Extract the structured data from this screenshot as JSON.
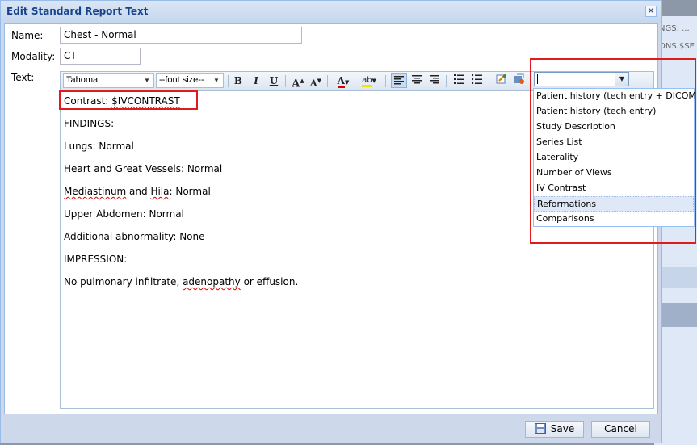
{
  "background": {
    "text_line1": "NGS: ...",
    "text_line2": "ONS $SE"
  },
  "dialog": {
    "title": "Edit Standard Report Text",
    "close_symbol": "✕",
    "fields": {
      "name_label": "Name:",
      "name_value": "Chest - Normal",
      "modality_label": "Modality:",
      "modality_value": "CT",
      "text_label": "Text:"
    }
  },
  "toolbar": {
    "font_family": "Tahoma",
    "font_size": "--font size--",
    "bold": "B",
    "italic": "I",
    "underline": "U",
    "grow_text": "A",
    "shrink_text": "A",
    "font_color": "A",
    "highlight": "ab",
    "icons": [
      "bold-icon",
      "italic-icon",
      "underline-icon",
      "increase-font-icon",
      "decrease-font-icon",
      "font-color-icon",
      "highlight-color-icon",
      "align-left-icon",
      "align-center-icon",
      "align-right-icon",
      "ordered-list-icon",
      "unordered-list-icon",
      "link-icon",
      "source-edit-icon"
    ]
  },
  "editor": {
    "lines": [
      "Contrast: $IVCONTRAST",
      "FINDINGS:",
      "Lungs: Normal",
      "Heart and Great Vessels: Normal",
      "Mediastinum and Hila: Normal",
      "Upper Abdomen: Normal",
      "Additional abnormality: None",
      "IMPRESSION:"
    ],
    "last_line": {
      "before": "No pulmonary infiltrate, ",
      "misspelled": "adenopathy",
      "after": " or effusion."
    },
    "med_part1": "Mediastinum",
    "med_part2": " and ",
    "med_part3": "Hila",
    "med_part4": ": Normal",
    "contrast_prefix": "Contrast: ",
    "contrast_var": "$IVCONTRAST"
  },
  "dropdown": {
    "value": "",
    "options": [
      "Patient history (tech entry + DICOM)",
      "Patient history (tech entry)",
      "Study Description",
      "Series List",
      "Laterality",
      "Number of Views",
      "IV Contrast",
      "Reformations",
      "Comparisons"
    ],
    "hover_index": 7
  },
  "footer": {
    "save_label": "Save",
    "cancel_label": "Cancel"
  },
  "colors": {
    "highlight_box": "#e01b1b",
    "title_text": "#15428b",
    "dialog_bg": "#cdd9ea"
  }
}
